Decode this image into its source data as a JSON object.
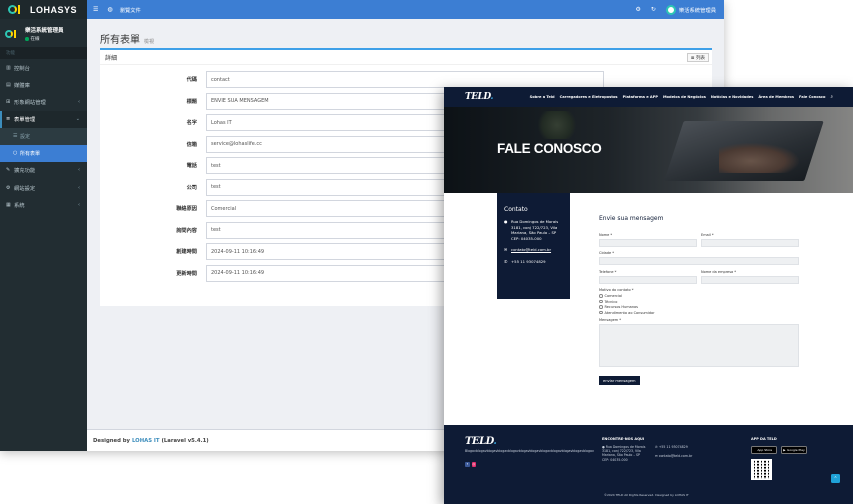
{
  "admin": {
    "brand": {
      "name": "LOHASYS"
    },
    "user": {
      "name": "樂活系統管理員",
      "status": "在線"
    },
    "nav_header": "功能",
    "nav": [
      {
        "icon": "▥",
        "label": "控制台"
      },
      {
        "icon": "▤",
        "label": "媒體庫"
      },
      {
        "icon": "⊞",
        "label": "形象網站管理"
      },
      {
        "icon": "≡",
        "label": "表單管理"
      },
      {
        "icon": "✎",
        "label": "擴充功能"
      },
      {
        "icon": "⚙",
        "label": "網站設定"
      },
      {
        "icon": "▦",
        "label": "系統"
      }
    ],
    "nav_sub": [
      {
        "icon": "☰",
        "label": "設定"
      },
      {
        "icon": "○",
        "label": "所有表單"
      }
    ],
    "topbar": {
      "preview": "瀏覽文件",
      "user": "樂活系統管理員"
    },
    "page": {
      "title": "所有表單",
      "subtitle": "檢視"
    },
    "card": {
      "title": "詳細",
      "list_button": "≣ 列表"
    },
    "fields": [
      {
        "label": "代碼",
        "value": "contact"
      },
      {
        "label": "標題",
        "value": "ENVIE SUA MENSAGEM"
      },
      {
        "label": "名字",
        "value": "Lohas IT"
      },
      {
        "label": "信箱",
        "value": "service@lohaslife.cc"
      },
      {
        "label": "電話",
        "value": "test"
      },
      {
        "label": "公司",
        "value": "test"
      },
      {
        "label": "聯絡原因",
        "value": "Comercial"
      },
      {
        "label": "詢問內容",
        "value": "test"
      },
      {
        "label": "創建時間",
        "value": "2024-09-11 10:16:49"
      },
      {
        "label": "更新時間",
        "value": "2024-09-11 10:16:49"
      }
    ],
    "footer": {
      "prefix": "Designed by",
      "brand": "LOHAS IT",
      "version": "(Laravel v5.4.1)"
    }
  },
  "site": {
    "logo": {
      "main": "TELD",
      "accent": "."
    },
    "menu": [
      "Sobre a Teld",
      "Carregadores e Eletropostos",
      "Plataforma e APP",
      "Modelos de Negócios",
      "Notícias e Novidades",
      "Área de Membros",
      "Fale Conosco"
    ],
    "hero_title": "FALE CONOSCO",
    "contact": {
      "title": "Contato",
      "address": "Rua Domingos de Morais 3181, conj 722/723, Vila Mariana, São Paulo – SP CEP: 04035-000",
      "email": "contato@teld.com.br",
      "phone": "+55 11 93074829"
    },
    "form": {
      "title": "Envie sua mensagem",
      "name_label": "Nome *",
      "email_label": "Email *",
      "city_label": "Cidade *",
      "phone_label": "Telefone *",
      "company_label": "Nome da empresa *",
      "reason_label": "Motivo do contato *",
      "reasons": [
        "Comercial",
        "Técnico",
        "Recursos Humanos",
        "Atendimento ao Consumidor"
      ],
      "message_label": "Mensagem *",
      "submit": "enviar mensagem"
    },
    "footer": {
      "description": "Blogavblogavblogavblogavblogavblogavblogavblogavblogavblogavblogavblogav",
      "social": [
        "f",
        "◎"
      ],
      "about_title": "ENCONTRE-NOS AQUI",
      "address": "Rua Domingos de Morais 3181, conj 722/723, Vila Mariana, São Paulo – SP CEP: 04035-000",
      "phone": "+55 11 93074829",
      "email": "contato@teld.com.br",
      "app_title": "APP DA TELD",
      "app_store": "App Store",
      "google_play": "Google Play",
      "copyright": "©2024 TELD All Rights Reserved. Designed by LOHAS IT",
      "back_to_top": "⌃"
    }
  },
  "colors": {
    "sidebar": "#222d32",
    "topbar": "#3c7ed3",
    "site_navy": "#0e1b35",
    "accent": "#3aa6e0"
  }
}
